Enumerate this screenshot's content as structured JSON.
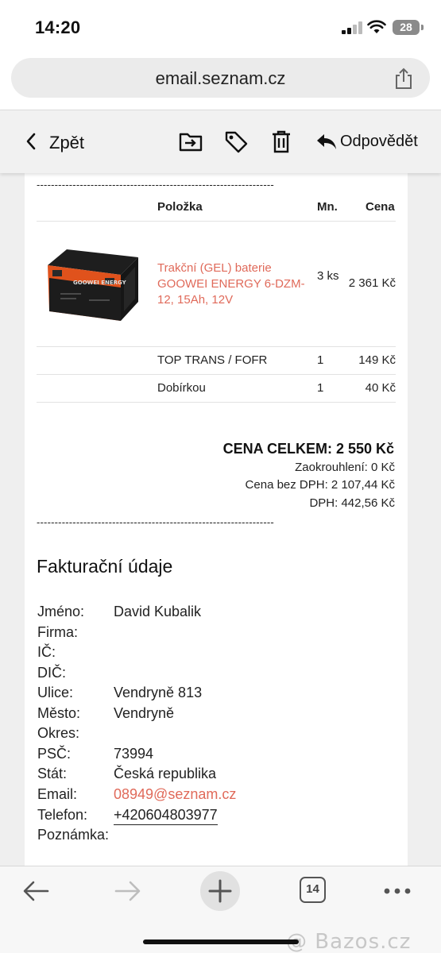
{
  "status_bar": {
    "time": "14:20",
    "battery": "28"
  },
  "browser": {
    "url": "email.seznam.cz",
    "tabs_count": "14"
  },
  "toolbar": {
    "back_label": "Zpět",
    "reply_label": "Odpovědět"
  },
  "separator": "------------------------------------------------------------------",
  "table": {
    "headers": {
      "item": "Položka",
      "qty": "Mn.",
      "price": "Cena"
    },
    "product": {
      "name": "Trakční (GEL) baterie GOOWEI ENERGY 6-DZM-12, 15Ah, 12V",
      "qty": "3 ks",
      "price": "2 361 Kč",
      "image_label": "GOOWEI ENERGY"
    },
    "rows": [
      {
        "name": "TOP TRANS / FOFR",
        "qty": "1",
        "price": "149 Kč"
      },
      {
        "name": "Dobírkou",
        "qty": "1",
        "price": "40 Kč"
      }
    ]
  },
  "totals": {
    "total": "CENA CELKEM: 2 550 Kč",
    "rounding": "Zaokrouhlení: 0 Kč",
    "without_vat": "Cena bez DPH: 2 107,44 Kč",
    "vat": "DPH: 442,56 Kč"
  },
  "billing": {
    "title": "Fakturační údaje",
    "fields": [
      {
        "label": "Jméno:",
        "value": "David Kubalik"
      },
      {
        "label": "Firma:",
        "value": ""
      },
      {
        "label": "IČ:",
        "value": ""
      },
      {
        "label": "DIČ:",
        "value": ""
      },
      {
        "label": "Ulice:",
        "value": "Vendryně 813"
      },
      {
        "label": "Město:",
        "value": "Vendryně"
      },
      {
        "label": "Okres:",
        "value": ""
      },
      {
        "label": "PSČ:",
        "value": "73994"
      },
      {
        "label": "Stát:",
        "value": "Česká republika"
      },
      {
        "label": "Email:",
        "value": "08949@seznam.cz"
      },
      {
        "label": "Telefon:",
        "value": "+420604803977"
      },
      {
        "label": "Poznámka:",
        "value": ""
      }
    ]
  },
  "watermark": "@ Bazos.cz",
  "colors": {
    "link": "#e06a5a",
    "toolbar_bg": "#f1f1f1",
    "battery_orange": "#e0521c"
  }
}
